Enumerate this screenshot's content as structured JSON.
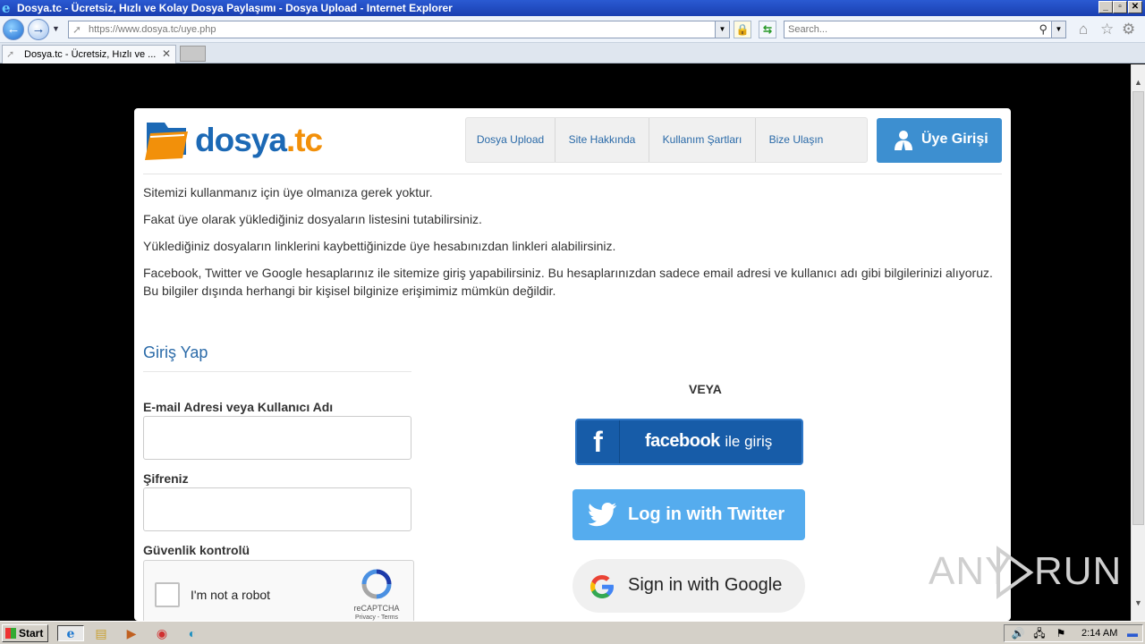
{
  "window": {
    "title": "Dosya.tc - Ücretsiz, Hızlı ve Kolay Dosya Paylaşımı - Dosya Upload - Internet Explorer"
  },
  "navbar": {
    "url_prefix": "https://www.dosya.tc/",
    "url_path": "uye.php",
    "search_placeholder": "Search..."
  },
  "tab": {
    "title": "Dosya.tc - Ücretsiz, Hızlı ve ..."
  },
  "site": {
    "logo_left": "dosya",
    "logo_right": ".tc",
    "nav": [
      "Dosya Upload",
      "Site Hakkında",
      "Kullanım Şartları",
      "Bize Ulaşın"
    ],
    "login_button": "Üye Girişi"
  },
  "content": {
    "paragraphs": [
      "Sitemizi kullanmanız için üye olmanıza gerek yoktur.",
      "Fakat üye olarak yüklediğiniz dosyaların listesini tutabilirsiniz.",
      "Yüklediğiniz dosyaların linklerini kaybettiğinizde üye hesabınızdan linkleri alabilirsiniz.",
      "Facebook, Twitter ve Google hesaplarınız ile sitemize giriş yapabilirsiniz. Bu hesaplarınızdan sadece email adresi ve kullanıcı adı gibi bilgilerinizi alıyoruz. Bu bilgiler dışında herhangi bir kişisel bilginize erişimimiz mümkün değildir."
    ]
  },
  "form": {
    "heading": "Giriş Yap",
    "email_label": "E-mail Adresi veya Kullanıcı Adı",
    "email_value": "",
    "password_label": "Şifreniz",
    "password_value": "",
    "captcha_label": "Güvenlik kontrolü",
    "captcha_text": "I'm not a robot",
    "captcha_brand": "reCAPTCHA",
    "captcha_links": "Privacy - Terms"
  },
  "social": {
    "or": "VEYA",
    "facebook_brand": "facebook",
    "facebook_suffix": "ile giriş",
    "twitter": "Log in with Twitter",
    "google": "Sign in with Google"
  },
  "watermark": {
    "left": "ANY",
    "right": "RUN"
  },
  "taskbar": {
    "start": "Start",
    "clock": "2:14 AM"
  },
  "colors": {
    "brand_blue": "#1c69b5",
    "brand_orange": "#f2900a",
    "facebook": "#175ca8",
    "twitter": "#55acee",
    "login_button": "#3d8fd0"
  }
}
